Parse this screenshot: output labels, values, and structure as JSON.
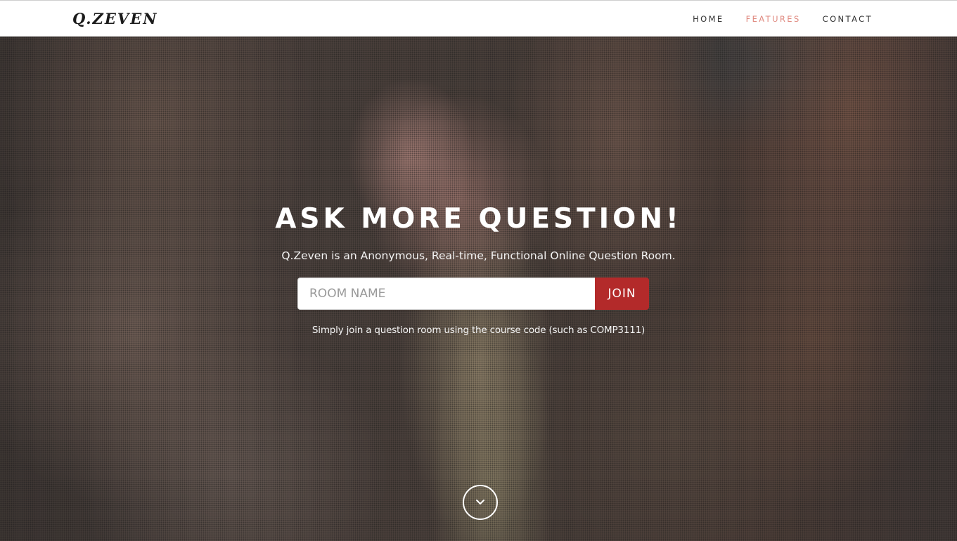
{
  "navbar": {
    "brand": "Q.ZEVEN",
    "links": [
      {
        "label": "HOME",
        "active": false
      },
      {
        "label": "FEATURES",
        "active": true
      },
      {
        "label": "CONTACT",
        "active": false
      }
    ]
  },
  "hero": {
    "headline": "ASK MORE QUESTION!",
    "tagline": "Q.Zeven is an Anonymous, Real-time, Functional Online Question Room.",
    "room_input": {
      "placeholder": "ROOM NAME",
      "value": ""
    },
    "join_label": "JOIN",
    "hint": "Simply join a question room using the course code (such as COMP3111)",
    "scroll_icon": "chevron-down-icon"
  },
  "colors": {
    "accent": "#b32a2a",
    "nav_active": "#e08a80",
    "nav_text": "#333333"
  }
}
